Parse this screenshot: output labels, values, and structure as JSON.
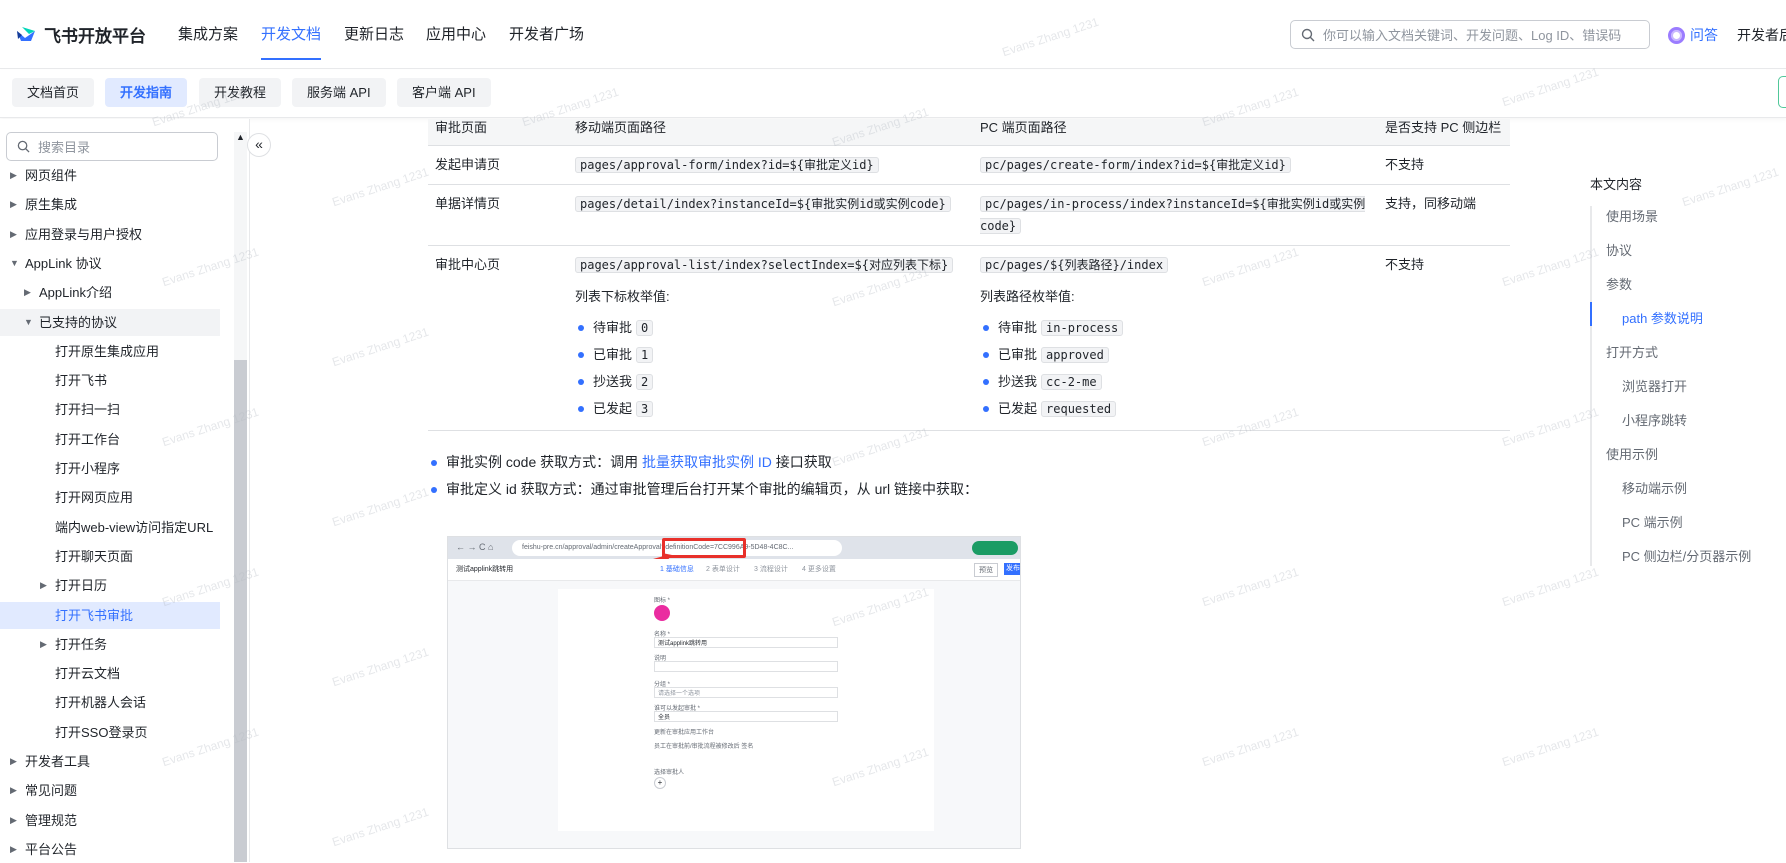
{
  "brand": {
    "name": "飞书开放平台"
  },
  "topnav": {
    "items": [
      "集成方案",
      "开发文档",
      "更新日志",
      "应用中心",
      "开发者广场"
    ],
    "active_index": 1,
    "search_placeholder": "你可以输入文档关键词、开发问题、Log ID、错误码",
    "ask_label": "问答",
    "dev_label": "开发者后"
  },
  "subnav": {
    "tabs": [
      "文档首页",
      "开发指南",
      "开发教程",
      "服务端 API",
      "客户端 API"
    ],
    "active_index": 1
  },
  "sidebar": {
    "search_placeholder": "搜索目录",
    "items": [
      {
        "label": "网页组件",
        "level": 0,
        "caret": "right"
      },
      {
        "label": "原生集成",
        "level": 0,
        "caret": "right"
      },
      {
        "label": "应用登录与用户授权",
        "level": 0,
        "caret": "right"
      },
      {
        "label": "AppLink 协议",
        "level": 0,
        "caret": "down"
      },
      {
        "label": "AppLink介绍",
        "level": 1,
        "caret": "right"
      },
      {
        "label": "已支持的协议",
        "level": 1,
        "caret": "down",
        "state": "hover"
      },
      {
        "label": "打开原生集成应用",
        "level": 2,
        "caret": ""
      },
      {
        "label": "打开飞书",
        "level": 2,
        "caret": ""
      },
      {
        "label": "打开扫一扫",
        "level": 2,
        "caret": ""
      },
      {
        "label": "打开工作台",
        "level": 2,
        "caret": ""
      },
      {
        "label": "打开小程序",
        "level": 2,
        "caret": ""
      },
      {
        "label": "打开网页应用",
        "level": 2,
        "caret": ""
      },
      {
        "label": "端内web-view访问指定URL",
        "level": 2,
        "caret": ""
      },
      {
        "label": "打开聊天页面",
        "level": 2,
        "caret": ""
      },
      {
        "label": "打开日历",
        "level": 2,
        "caret": "right"
      },
      {
        "label": "打开飞书审批",
        "level": 2,
        "caret": "",
        "state": "selected"
      },
      {
        "label": "打开任务",
        "level": 2,
        "caret": "right"
      },
      {
        "label": "打开云文档",
        "level": 2,
        "caret": ""
      },
      {
        "label": "打开机器人会话",
        "level": 2,
        "caret": ""
      },
      {
        "label": "打开SSO登录页",
        "level": 2,
        "caret": ""
      },
      {
        "label": "开发者工具",
        "level": 0,
        "caret": "right"
      },
      {
        "label": "常见问题",
        "level": 0,
        "caret": "right"
      },
      {
        "label": "管理规范",
        "level": 0,
        "caret": "right"
      },
      {
        "label": "平台公告",
        "level": 0,
        "caret": "right"
      }
    ]
  },
  "table": {
    "headers": [
      "审批页面",
      "移动端页面路径",
      "PC 端页面路径",
      "是否支持 PC 侧边栏"
    ],
    "rows": [
      {
        "page": "发起申请页",
        "mobile": "pages/approval-form/index?id=${审批定义id}",
        "pc": "pc/pages/create-form/index?id=${审批定义id}",
        "sidebar": "不支持"
      },
      {
        "page": "单据详情页",
        "mobile": "pages/detail/index?instanceId=${审批实例id或实例code}",
        "pc": "pc/pages/in-process/index?instanceId=${审批实例id或实例code}",
        "sidebar": "支持，同移动端"
      },
      {
        "page": "审批中心页",
        "mobile": "pages/approval-list/index?selectIndex=${对应列表下标}",
        "mobile_enum_title": "列表下标枚举值:",
        "mobile_enum": [
          {
            "label": "待审批",
            "value": "0"
          },
          {
            "label": "已审批",
            "value": "1"
          },
          {
            "label": "抄送我",
            "value": "2"
          },
          {
            "label": "已发起",
            "value": "3"
          }
        ],
        "pc": "pc/pages/${列表路径}/index",
        "pc_enum_title": "列表路径枚举值:",
        "pc_enum": [
          {
            "label": "待审批",
            "value": "in-process"
          },
          {
            "label": "已审批",
            "value": "approved"
          },
          {
            "label": "抄送我",
            "value": "cc-2-me"
          },
          {
            "label": "已发起",
            "value": "requested"
          }
        ],
        "sidebar": "不支持"
      }
    ]
  },
  "notes": {
    "n1_pre": "审批实例 code 获取方式：调用 ",
    "n1_link": "批量获取审批实例 ID",
    "n1_post": " 接口获取",
    "n2": "审批定义 id 获取方式：通过审批管理后台打开某个审批的编辑页，从 url 链接中获取："
  },
  "screenshot": {
    "url": "feishu-pre.cn/approval/admin/createApproval?definitionCode=7CC996A9-5D48-4C8C...",
    "back_title": "测试applink跳转用",
    "steps": [
      "1 基础信息",
      "2 表单设计",
      "3 流程设计",
      "4 更多设置"
    ],
    "fields": [
      "图标 *",
      "名称 *",
      "说明",
      "分组 *",
      "谁可以发起审批 *",
      "选择审批人"
    ],
    "name_value": "测试applink跳转用",
    "group_value": "请选择一个选项",
    "who_value": "全员",
    "checkboxes": [
      "更新在审批应用工作台",
      "员工在审批前/审批流程被修改后 签名"
    ],
    "buttons": [
      "预览",
      "发布"
    ]
  },
  "toc": {
    "title": "本文内容",
    "items": [
      {
        "label": "使用场景",
        "level": 0
      },
      {
        "label": "协议",
        "level": 0
      },
      {
        "label": "参数",
        "level": 0
      },
      {
        "label": "path 参数说明",
        "level": 1,
        "active": true
      },
      {
        "label": "打开方式",
        "level": 0
      },
      {
        "label": "浏览器打开",
        "level": 1
      },
      {
        "label": "小程序跳转",
        "level": 1
      },
      {
        "label": "使用示例",
        "level": 0
      },
      {
        "label": "移动端示例",
        "level": 1
      },
      {
        "label": "PC 端示例",
        "level": 1
      },
      {
        "label": "PC 侧边栏/分页器示例",
        "level": 1
      }
    ]
  },
  "watermark": "Evans Zhang 1231",
  "colors": {
    "accent": "#3370ff",
    "highlight": "#e1eaff",
    "annotation": "#e8302a"
  }
}
